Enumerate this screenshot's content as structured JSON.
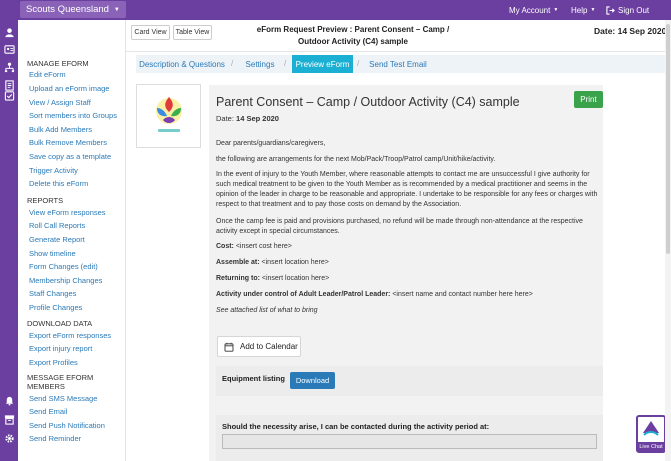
{
  "topbar": {
    "org": "Scouts Queensland",
    "my_account": "My Account",
    "help": "Help",
    "sign_out": "Sign Out"
  },
  "header": {
    "card_view": "Card View",
    "table_view": "Table View",
    "title_line1": "eForm Request Preview : Parent Consent – Camp /",
    "title_line2": "Outdoor Activity (C4) sample",
    "date": "Date: 14 Sep 2020"
  },
  "sidebar": {
    "manage_heading": "MANAGE EFORM",
    "manage": [
      "Edit eForm",
      "Upload an eForm image",
      "View / Assign Staff",
      "Sort members into Groups",
      "Bulk Add Members",
      "Bulk Remove Members",
      "Save copy as a template",
      "Trigger Activity",
      "Delete this eForm"
    ],
    "reports_heading": "REPORTS",
    "reports": [
      "View eForm responses",
      "Roll Call Reports",
      "Generate Report",
      "Show timeline",
      "Form Changes (edit)",
      "Membership Changes",
      "Staff Changes",
      "Profile Changes"
    ],
    "download_heading": "DOWNLOAD DATA",
    "download": [
      "Export eForm responses",
      "Export injury report",
      "Export Profiles"
    ],
    "message_heading_1": "MESSAGE EFORM",
    "message_heading_2": "MEMBERS",
    "message": [
      "Send SMS Message",
      "Send Email",
      "Send Push Notification",
      "Send Reminder"
    ]
  },
  "tabs": [
    "Description & Questions",
    "Settings",
    "Preview eForm",
    "Send Test Email"
  ],
  "form": {
    "title": "Parent Consent – Camp / Outdoor Activity (C4) sample",
    "date_label": "Date:",
    "date_value": "14 Sep 2020",
    "print": "Print",
    "greeting": "Dear parents/guardians/caregivers,",
    "intro": "the following are arrangements for the next Mob/Pack/Troop/Patrol camp/Unit/hike/activity.",
    "injury": "In the event of injury to the Youth Member, where reasonable attempts to contact me are unsuccessful I give authority for such medical treatment to be given to the Youth Member as is recommended by a medical practitioner and seems in the opinion of the leader in charge to be reasonable and appropriate. I undertake to be responsible for any fees or charges with respect to that treatment and to pay those costs on demand by the Association.",
    "fee": "Once the camp fee is paid and provisions purchased, no refund will be made through non-attendance at the respective activity except in special circumstances.",
    "cost_label": "Cost:",
    "cost_value": "<insert cost here>",
    "assemble_label": "Assemble at:",
    "assemble_value": "<insert location here>",
    "returning_label": "Returning to:",
    "returning_value": "<insert location here>",
    "control_label": "Activity under control of Adult Leader/Patrol Leader:",
    "control_value": "<insert name and contact number here here>",
    "attached": "See attached list of what to bring",
    "add_calendar": "Add to Calendar",
    "equipment_label": "Equipment listing",
    "download": "Download",
    "contact_label": "Should the necessity arise, I can be contacted during the activity period at:",
    "contact_value": ""
  },
  "livechat": "Live Chat",
  "colors": {
    "brand": "#6b3fa0",
    "tab_active": "#1bb0d3",
    "link": "#2a7ab8",
    "print": "#3aa24a"
  }
}
